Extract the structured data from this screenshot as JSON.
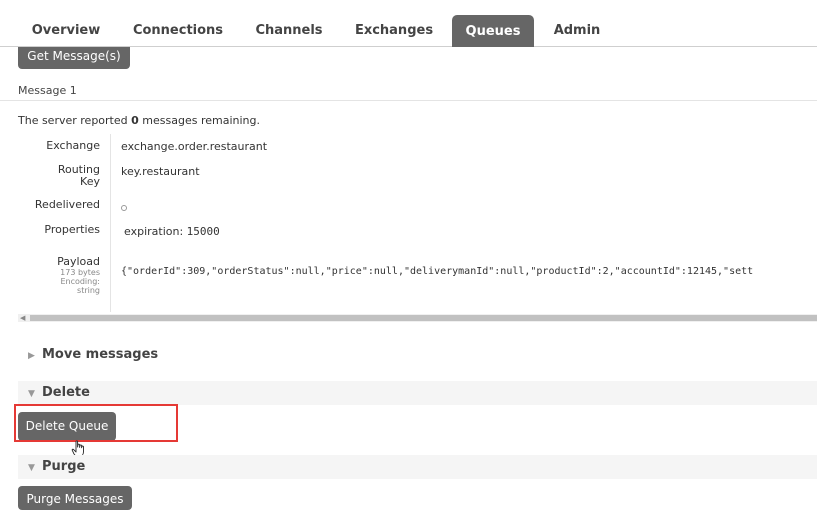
{
  "nav": {
    "tabs": [
      {
        "label": "Overview"
      },
      {
        "label": "Connections"
      },
      {
        "label": "Channels"
      },
      {
        "label": "Exchanges"
      },
      {
        "label": "Queues"
      },
      {
        "label": "Admin"
      }
    ],
    "active_tab": "Queues"
  },
  "get_messages_button": "Get Message(s)",
  "message": {
    "title": "Message 1",
    "server_text_prefix": "The server reported ",
    "remaining_count": "0",
    "server_text_suffix": " messages remaining.",
    "fields": {
      "exchange_label": "Exchange",
      "exchange_value": "exchange.order.restaurant",
      "routing_key_label_line1": "Routing",
      "routing_key_label_line2": "Key",
      "routing_key_value": "key.restaurant",
      "redelivered_label": "Redelivered",
      "properties_label": "Properties",
      "properties_key": "expiration:",
      "properties_value": "15000",
      "payload_label": "Payload",
      "payload_size": "173 bytes",
      "payload_encoding_label": "Encoding:",
      "payload_encoding_value": "string",
      "payload_value": "{\"orderId\":309,\"orderStatus\":null,\"price\":null,\"deliverymanId\":null,\"productId\":2,\"accountId\":12145,\"sett"
    }
  },
  "sections": {
    "move_messages": "Move messages",
    "delete": "Delete",
    "delete_queue_button": "Delete Queue",
    "purge": "Purge",
    "purge_messages_button": "Purge Messages"
  },
  "colors": {
    "button_bg": "#666666",
    "active_tab_bg": "#666666",
    "highlight_border": "#e53935",
    "section_shade": "#f5f5f5"
  }
}
